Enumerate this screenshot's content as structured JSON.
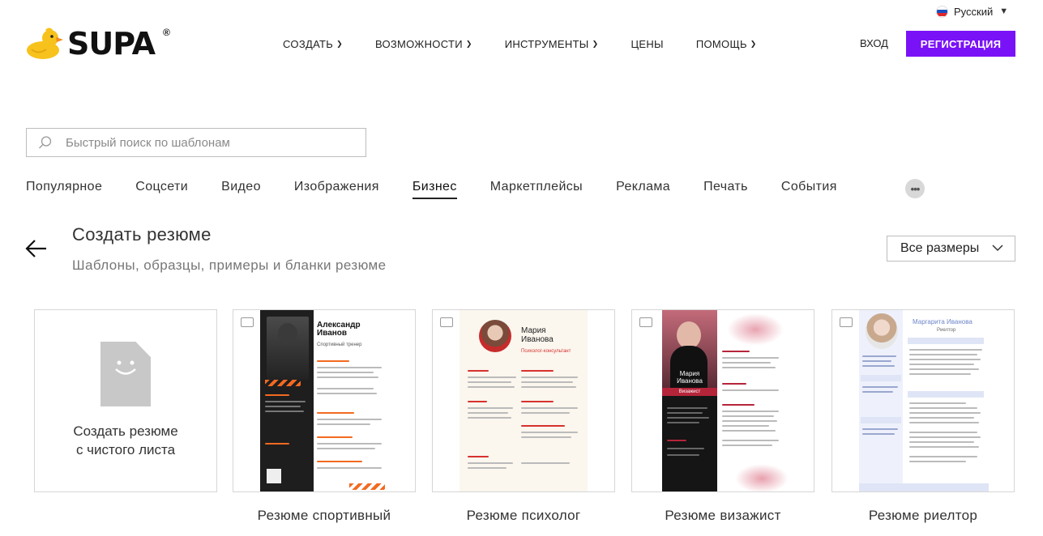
{
  "header": {
    "language": "Русский",
    "logo_text": "SUPA",
    "logo_reg": "®",
    "nav": [
      "СОЗДАТЬ",
      "ВОЗМОЖНОСТИ",
      "ИНСТРУМЕНТЫ",
      "ЦЕНЫ",
      "ПОМОЩЬ"
    ],
    "login": "ВХОД",
    "register": "РЕГИСТРАЦИЯ"
  },
  "search": {
    "placeholder": "Быстрый поиск по шаблонам"
  },
  "categories": [
    "Популярное",
    "Соцсети",
    "Видео",
    "Изображения",
    "Бизнес",
    "Маркетплейсы",
    "Реклама",
    "Печать",
    "События"
  ],
  "active_category": "Бизнес",
  "more_label": "•••",
  "section": {
    "title": "Создать резюме",
    "subtitle": "Шаблоны, образцы, примеры и бланки резюме",
    "size_filter": "Все размеры"
  },
  "blank_card": {
    "line1": "Создать резюме",
    "line2": "с чистого листа"
  },
  "templates": [
    {
      "label": "Резюме спортивный",
      "name_text": "Александр Иванов",
      "role": "Спортивный тренер",
      "accent": "#f26a21"
    },
    {
      "label": "Резюме психолог",
      "name_text": "Мария Иванова",
      "role": "Психолог-консультант",
      "accent": "#d6322e"
    },
    {
      "label": "Резюме визажист",
      "name_text": "Мария Иванова",
      "role": "Визажист",
      "accent": "#b5253a"
    },
    {
      "label": "Резюме риелтор",
      "name_text": "Маргарита Иванова",
      "role": "Риелтор",
      "accent": "#6d86c9"
    }
  ],
  "colors": {
    "brand_purple": "#7a12f7",
    "text": "#222222",
    "muted": "#777777"
  }
}
